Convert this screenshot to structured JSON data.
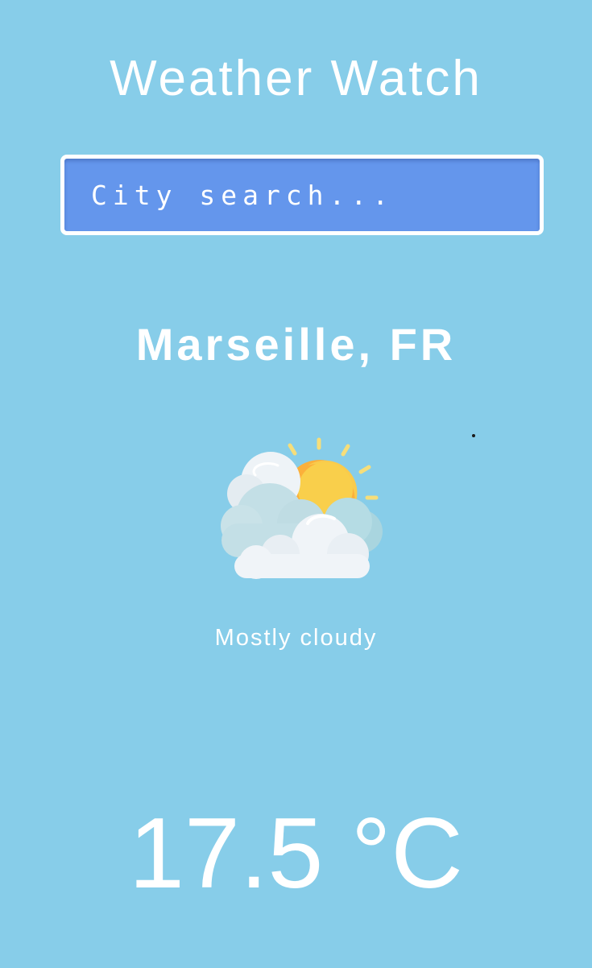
{
  "header": {
    "title": "Weather Watch"
  },
  "search": {
    "placeholder": "City search...",
    "value": ""
  },
  "location": {
    "name": "Marseille, FR"
  },
  "current": {
    "icon": "partly-cloudy-icon",
    "condition": "Mostly cloudy",
    "temperature": "17.5 °C"
  },
  "colors": {
    "background": "#87CDE9",
    "search_field": "#6496EC",
    "text": "#FFFFFF",
    "sun": "#FBB03B",
    "cloud": "#EEF3F7"
  }
}
